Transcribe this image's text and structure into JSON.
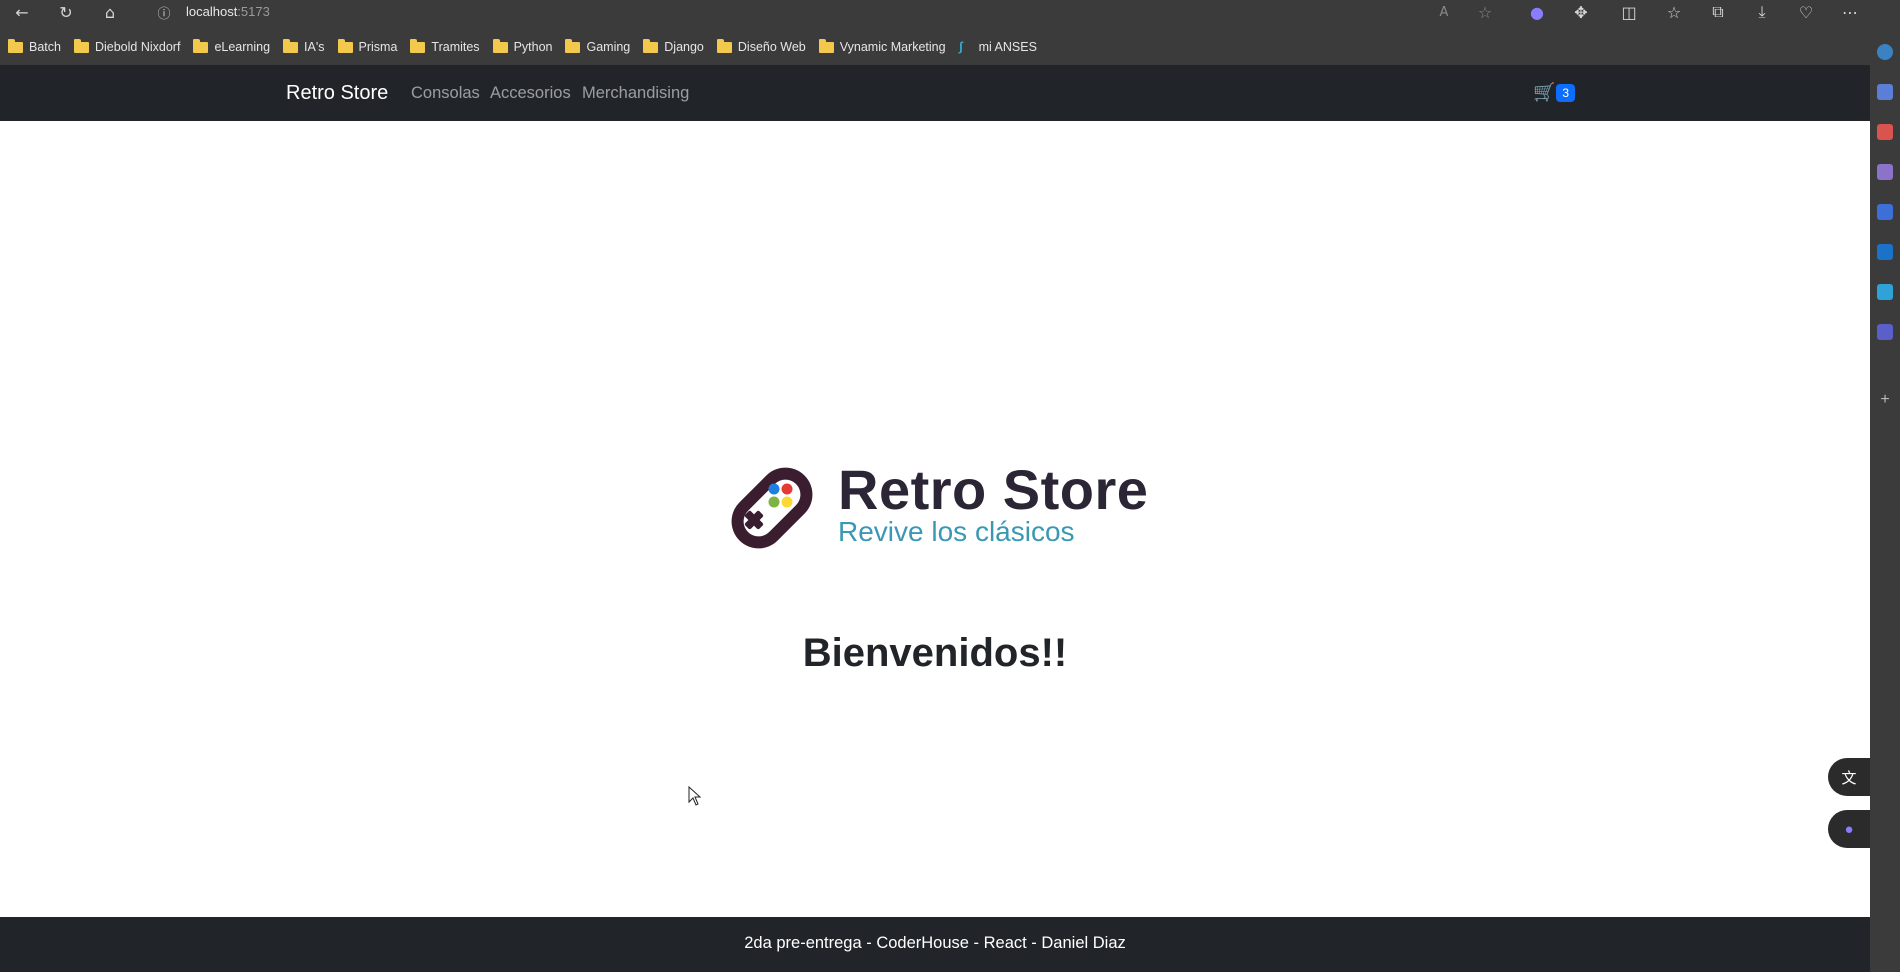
{
  "browser": {
    "url_host": "localhost",
    "url_port": ":5173",
    "bookmarks": [
      {
        "label": "Batch",
        "icon": "folder-icon"
      },
      {
        "label": "Diebold Nixdorf",
        "icon": "folder-icon"
      },
      {
        "label": "eLearning",
        "icon": "folder-icon"
      },
      {
        "label": "IA's",
        "icon": "folder-icon"
      },
      {
        "label": "Prisma",
        "icon": "folder-icon"
      },
      {
        "label": "Tramites",
        "icon": "folder-icon"
      },
      {
        "label": "Python",
        "icon": "folder-icon"
      },
      {
        "label": "Gaming",
        "icon": "folder-icon"
      },
      {
        "label": "Django",
        "icon": "folder-icon"
      },
      {
        "label": "Diseño Web",
        "icon": "folder-icon"
      },
      {
        "label": "Vynamic Marketing",
        "icon": "folder-icon"
      },
      {
        "label": "mi ANSES",
        "icon": "anses-icon"
      }
    ]
  },
  "navbar": {
    "brand": "Retro Store",
    "links": [
      "Consolas",
      "Accesorios",
      "Merchandising"
    ],
    "cart_count": "3"
  },
  "hero": {
    "logo_title": "Retro Store",
    "logo_subtitle": "Revive los clásicos",
    "welcome": "Bienvenidos!!"
  },
  "footer": {
    "text": "2da pre-entrega - CoderHouse - React - Daniel Diaz"
  },
  "colors": {
    "navbar_bg": "#212529",
    "badge": "#0d6efd",
    "logo_dark": "#2c2535",
    "logo_accent": "#3a98b5"
  }
}
